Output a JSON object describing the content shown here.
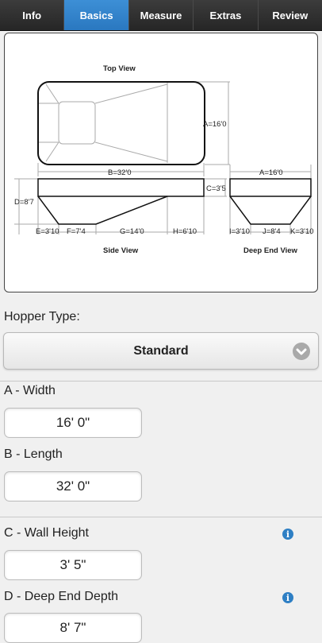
{
  "tabs": [
    {
      "label": "Info"
    },
    {
      "label": "Basics"
    },
    {
      "label": "Measure"
    },
    {
      "label": "Extras"
    },
    {
      "label": "Review"
    }
  ],
  "active_tab": "Basics",
  "diagram": {
    "top_view_title": "Top View",
    "side_view_title": "Side View",
    "deep_end_view_title": "Deep End View",
    "dims": {
      "A": "A=16'0",
      "B": "B=32'0",
      "C": "C=3'5",
      "D": "D=8'7",
      "E": "E=3'10",
      "F": "F=7'4",
      "G": "G=14'0",
      "H": "H=6'10",
      "A2": "A=16'0",
      "I": "I=3'10",
      "J": "J=8'4",
      "K": "K=3'10"
    }
  },
  "hopper": {
    "label": "Hopper Type:",
    "value": "Standard",
    "arrow_icon": "chevron-down-icon"
  },
  "fields": {
    "a": {
      "label": "A - Width",
      "value": "16' 0\""
    },
    "b": {
      "label": "B - Length",
      "value": "32' 0\""
    },
    "c": {
      "label": "C - Wall Height",
      "value": "3' 5\"",
      "info_icon": "info-icon"
    },
    "d": {
      "label": "D - Deep End Depth",
      "value": "8' 7\"",
      "info_icon": "info-icon"
    }
  },
  "colors": {
    "tab_active": "#2a78c0",
    "tab_bg": "#2b2b2b",
    "info": "#2e7fc4"
  }
}
